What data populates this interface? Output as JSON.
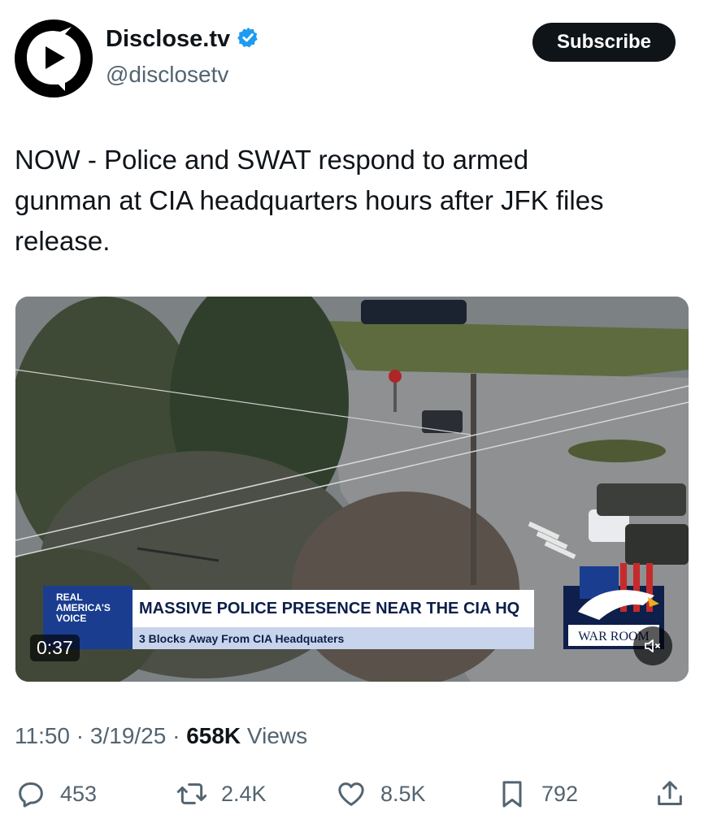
{
  "author": {
    "display_name": "Disclose.tv",
    "handle": "@disclosetv",
    "verified": true,
    "verified_color": "#1d9bf0"
  },
  "subscribe_label": "Subscribe",
  "tweet_text": "NOW - Police and SWAT respond to armed\ngunman at CIA headquarters hours after JFK files\nrelease.",
  "video": {
    "duration": "0:37",
    "muted": true,
    "chyron": {
      "logo_lines": [
        "REAL",
        "AMERICA'S",
        "VOICE"
      ],
      "headline": "MASSIVE POLICE PRESENCE NEAR THE CIA HQ",
      "subhead": "3 Blocks Away From CIA Headquaters",
      "badge": "WAR ROOM"
    }
  },
  "meta": {
    "time": "11:50",
    "date": "3/19/25",
    "views_count": "658K",
    "views_label": "Views"
  },
  "actions": {
    "replies": "453",
    "reposts": "2.4K",
    "likes": "8.5K",
    "bookmarks": "792"
  },
  "icons": [
    "play-logo-icon",
    "verified-badge-icon",
    "mute-icon",
    "reply-icon",
    "repost-icon",
    "like-icon",
    "bookmark-icon",
    "share-icon"
  ]
}
